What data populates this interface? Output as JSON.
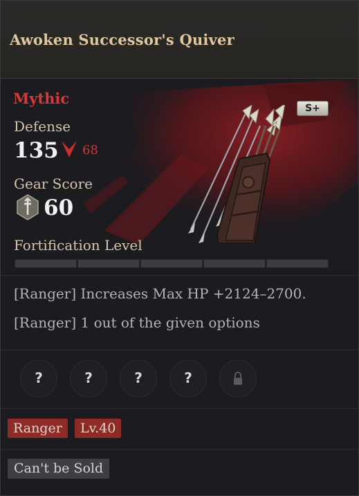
{
  "item": {
    "name": "Awoken Successor's Quiver",
    "grade": "Mythic",
    "tier_badge": "S+",
    "defense": {
      "label": "Defense",
      "value": "135",
      "change": "68",
      "change_icon": "down-arrow-icon"
    },
    "gear_score": {
      "label": "Gear Score",
      "value": "60",
      "icon": "gear-score-icon"
    },
    "fortification": {
      "label": "Fortification Level",
      "segments": 5,
      "filled": 0
    },
    "effects": [
      "[Ranger] Increases Max HP +2124–2700.",
      "[Ranger] 1 out of the given options"
    ],
    "sockets": [
      {
        "symbol": "?",
        "locked": false
      },
      {
        "symbol": "?",
        "locked": false
      },
      {
        "symbol": "?",
        "locked": false
      },
      {
        "symbol": "?",
        "locked": false
      },
      {
        "symbol": "lock",
        "locked": true
      }
    ],
    "tags": [
      "Ranger",
      "Lv.40"
    ],
    "trade_status": "Can't be Sold"
  },
  "colors": {
    "grade": "#d63a38",
    "title": "#e0c7a0",
    "tag_bg": "#8e2b27",
    "splash": "#7a1e22"
  }
}
